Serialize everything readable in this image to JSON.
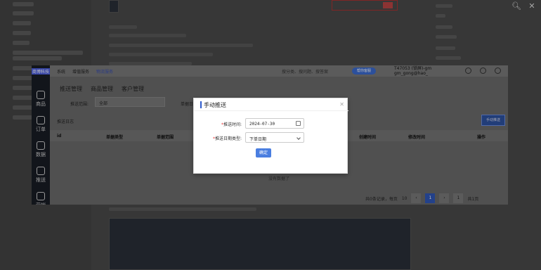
{
  "window": {
    "search_icon": "search-icon",
    "close_icon": "close-icon"
  },
  "app": {
    "logo": "商博科技",
    "top_menu": [
      "系统",
      "增值服务",
      "物流服务"
    ],
    "search_placeholder": "搜分类、搜问题、搜答案",
    "pill_label": "帮你客服",
    "user_line1": "T47053 (锁屏)-gm",
    "user_line2": "gm_gong@hao_",
    "sidebar": [
      "商品",
      "订单",
      "数据",
      "推送",
      "营销"
    ],
    "tabs": [
      "推送管理",
      "商品管理",
      "客户管理"
    ],
    "filter_label": "推送范围:",
    "filter_value": "全部",
    "filter_label2": "单据日期",
    "list_title": "推送日志",
    "push_button": "手动推送",
    "table_headers": [
      "id",
      "单据类型",
      "单据范围",
      "创建时间",
      "修改时间",
      "操作"
    ],
    "empty_text": "没有数据了",
    "pager": {
      "summary": "共0条记录，每页",
      "page_size": "10",
      "current_page": "1",
      "goto": "1",
      "total_pages": "共1页"
    }
  },
  "modal": {
    "title": "手动推送",
    "push_time_label": "推送时间:",
    "push_time_value": "2024-07-30",
    "date_type_label": "推送日期类型:",
    "date_type_value": "下单日期",
    "confirm_label": "确定",
    "required_mark": "*"
  }
}
